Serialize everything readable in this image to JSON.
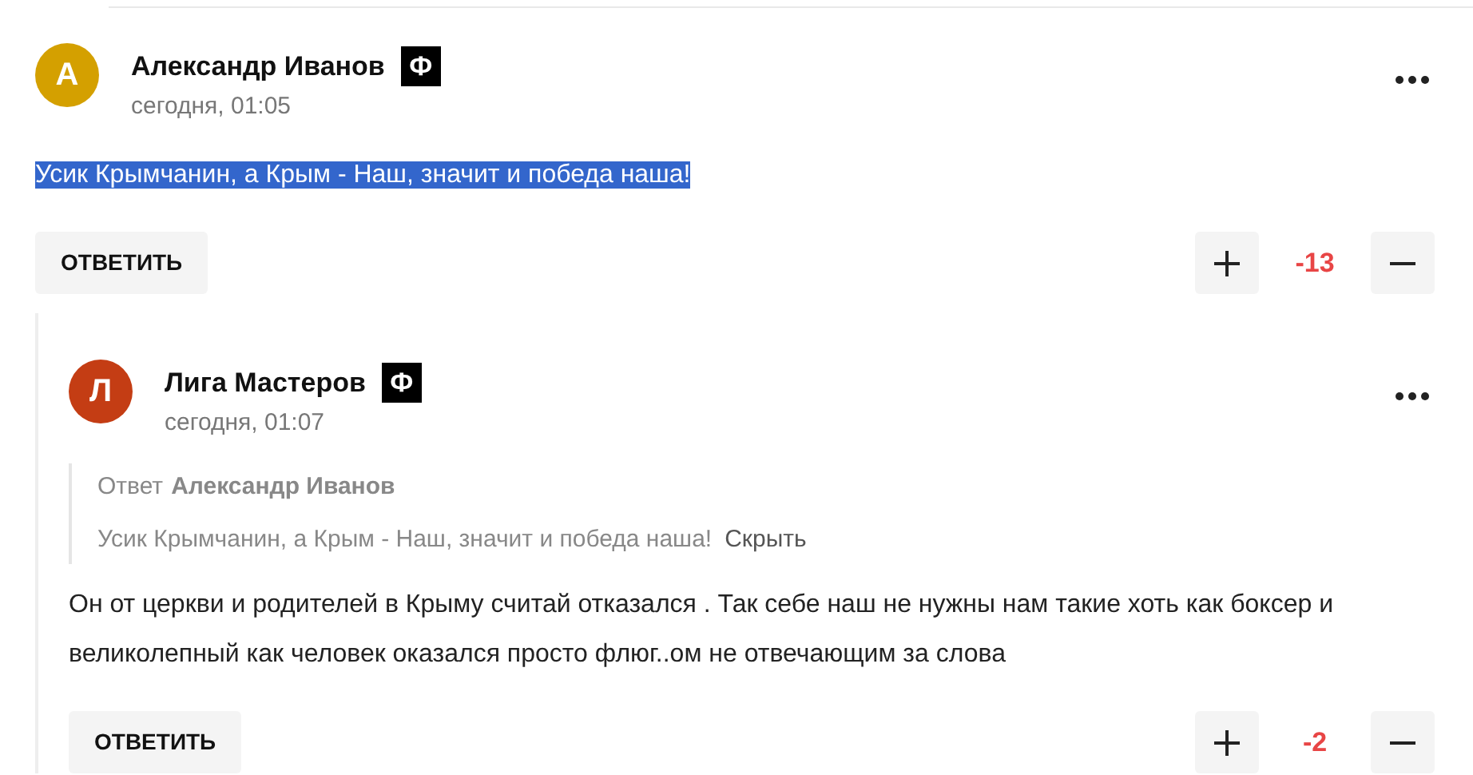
{
  "comments": [
    {
      "author": "Александр Иванов",
      "initial": "А",
      "color": "#d4a000",
      "badge": "Ф",
      "time": "сегодня, 01:05",
      "text": "Усик Крымчанин, а Крым - Наш, значит и победа наша!",
      "text_highlighted": true,
      "reply_button": "ОТВЕТИТЬ",
      "score": "-13",
      "replies": [
        {
          "author": "Лига Мастеров",
          "initial": "Л",
          "color": "#c43d14",
          "badge": "Ф",
          "time": "сегодня, 01:07",
          "quote": {
            "label": "Ответ",
            "author": "Александр Иванов",
            "text": "Усик Крымчанин, а Крым - Наш, значит и победа наша!",
            "hide_link": "Скрыть"
          },
          "text": "Он от церкви и родителей в Крыму считай отказался . Так себе наш не нужны нам такие хоть как боксер и великолепный как человек оказался просто флюг..ом не отвечающим за слова",
          "text_highlighted": false,
          "reply_button": "ОТВЕТИТЬ",
          "score": "-2"
        }
      ]
    }
  ]
}
